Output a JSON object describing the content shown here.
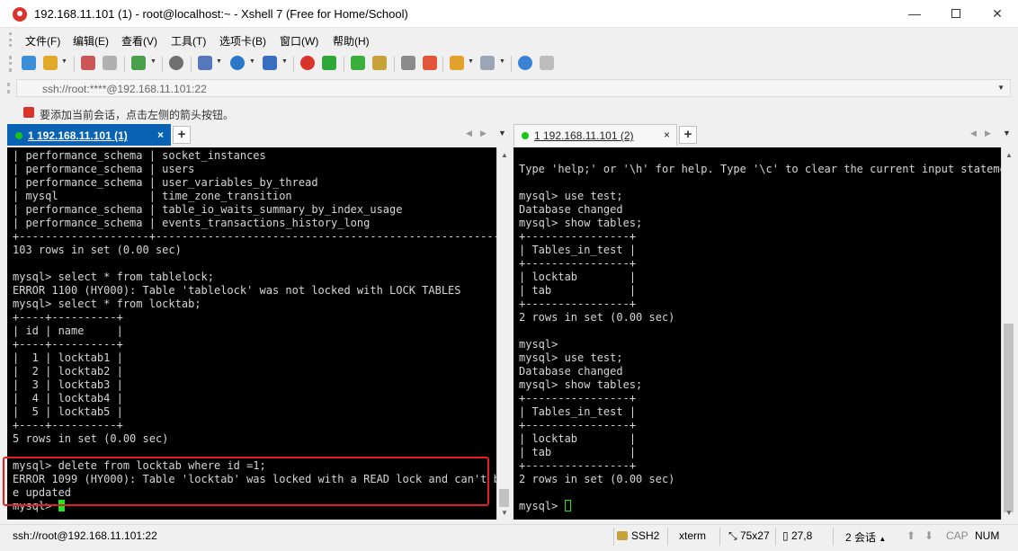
{
  "window": {
    "title": "192.168.11.101  (1)   - root@localhost:~ - Xshell 7 (Free for Home/School)",
    "minimize": "—",
    "close": "✕"
  },
  "menu": [
    "文件(F)",
    "编辑(E)",
    "查看(V)",
    "工具(T)",
    "选项卡(B)",
    "窗口(W)",
    "帮助(H)"
  ],
  "toolbar_icons": [
    "new-session-icon",
    "open-folder-icon",
    "reconnect-icon",
    "disconnect-icon",
    "properties-icon",
    "find-icon",
    "transfer-icon",
    "globe-icon",
    "font-icon",
    "xftp-icon",
    "xmanager-icon",
    "fullscreen-icon",
    "lock-icon",
    "keyboard-icon",
    "highlight-icon",
    "compose-icon",
    "layout-icon",
    "help-icon",
    "chat-icon"
  ],
  "address": {
    "value": "ssh://root:****@192.168.11.101:22"
  },
  "hint": {
    "text": "要添加当前会话，点击左侧的箭头按钮。"
  },
  "tabs": {
    "left": {
      "label": "1 192.168.11.101  (1)",
      "close": "×",
      "add": "+"
    },
    "right": {
      "label": "1 192.168.11.101  (2)",
      "close": "×",
      "add": "+"
    }
  },
  "terminal_left": {
    "lines": [
      "| performance_schema | socket_instances",
      "| performance_schema | users",
      "| performance_schema | user_variables_by_thread",
      "| mysql              | time_zone_transition",
      "| performance_schema | table_io_waits_summary_by_index_usage",
      "| performance_schema | events_transactions_history_long",
      "+--------------------+------------------------------------------------------",
      "103 rows in set (0.00 sec)",
      "",
      "mysql> select * from tablelock;",
      "ERROR 1100 (HY000): Table 'tablelock' was not locked with LOCK TABLES",
      "mysql> select * from locktab;",
      "+----+----------+",
      "| id | name     |",
      "+----+----------+",
      "|  1 | locktab1 |",
      "|  2 | locktab2 |",
      "|  3 | locktab3 |",
      "|  4 | locktab4 |",
      "|  5 | locktab5 |",
      "+----+----------+",
      "5 rows in set (0.00 sec)",
      "",
      "mysql> delete from locktab where id =1;",
      "ERROR 1099 (HY000): Table 'locktab' was locked with a READ lock and can't b",
      "e updated"
    ],
    "prompt": "mysql> "
  },
  "terminal_right": {
    "lines": [
      "",
      "Type 'help;' or '\\h' for help. Type '\\c' to clear the current input stateme",
      "",
      "mysql> use test;",
      "Database changed",
      "mysql> show tables;",
      "+----------------+",
      "| Tables_in_test |",
      "+----------------+",
      "| locktab        |",
      "| tab            |",
      "+----------------+",
      "2 rows in set (0.00 sec)",
      "",
      "mysql>",
      "mysql> use test;",
      "Database changed",
      "mysql> show tables;",
      "+----------------+",
      "| Tables_in_test |",
      "+----------------+",
      "| locktab        |",
      "| tab            |",
      "+----------------+",
      "2 rows in set (0.00 sec)",
      ""
    ],
    "prompt": "mysql> "
  },
  "status": {
    "connection": "ssh://root@192.168.11.101:22",
    "protocol": "SSH2",
    "terminal": "xterm",
    "size": "75x27",
    "position": "27,8",
    "sessions": "2 会话",
    "cap": "CAP",
    "num": "NUM"
  },
  "colors": {
    "active_tab": "#0a62b4",
    "cursor": "#1ee81e",
    "highlight_box": "#e02020",
    "status_dot": "#17c417"
  }
}
